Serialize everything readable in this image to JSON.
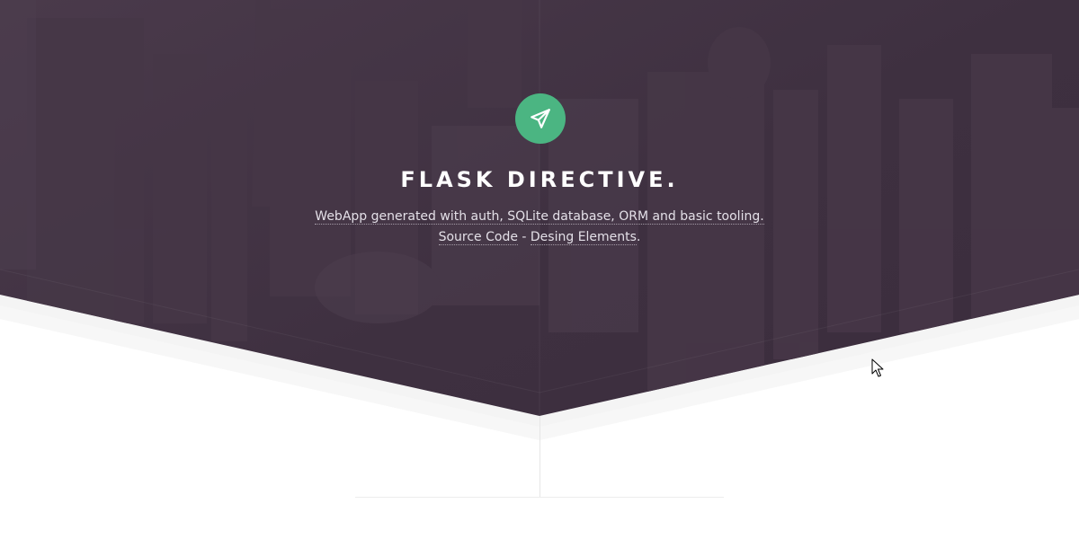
{
  "hero": {
    "title": "FLASK DIRECTIVE.",
    "description": "WebApp generated with auth, SQLite database, ORM and basic tooling.",
    "links": {
      "source_code_label": "Source Code",
      "separator": " - ",
      "design_elements_label": "Desing Elements",
      "trailing": "."
    },
    "logo_icon": "paper-plane-icon"
  },
  "colors": {
    "hero_overlay": "#3f3040",
    "logo_background": "#4bb582",
    "page_background": "#ffffff",
    "title_text": "#ffffff"
  }
}
